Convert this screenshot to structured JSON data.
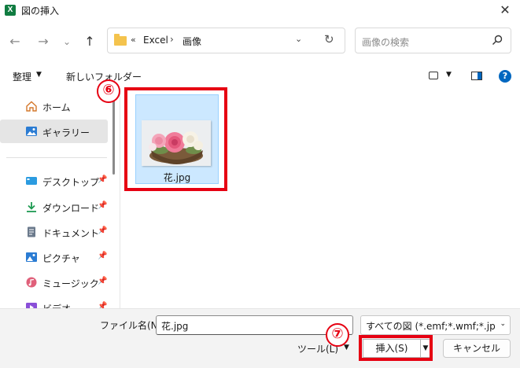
{
  "window": {
    "title": "図の挿入",
    "app_icon": "excel-icon",
    "close_label": "✕"
  },
  "nav": {
    "back": "←",
    "forward": "→",
    "recent": "⌄",
    "up": "↑"
  },
  "address": {
    "chevron": "«",
    "parts": [
      "Excel",
      "画像"
    ],
    "separator": "›"
  },
  "search": {
    "placeholder": "画像の検索"
  },
  "toolbar": {
    "organize": "整理",
    "new_folder": "新しいフォルダー"
  },
  "sidebar": {
    "items": [
      {
        "label": "ホーム",
        "icon": "home-icon",
        "pinned": false,
        "selected": false
      },
      {
        "label": "ギャラリー",
        "icon": "gallery-icon",
        "pinned": false,
        "selected": true
      },
      {
        "label": "デスクトップ",
        "icon": "desktop-icon",
        "pinned": true,
        "selected": false
      },
      {
        "label": "ダウンロード",
        "icon": "download-icon",
        "pinned": true,
        "selected": false
      },
      {
        "label": "ドキュメント",
        "icon": "document-icon",
        "pinned": true,
        "selected": false
      },
      {
        "label": "ピクチャ",
        "icon": "pictures-icon",
        "pinned": true,
        "selected": false
      },
      {
        "label": "ミュージック",
        "icon": "music-icon",
        "pinned": true,
        "selected": false
      },
      {
        "label": "ビデオ",
        "icon": "video-icon",
        "pinned": true,
        "selected": false
      }
    ]
  },
  "files": [
    {
      "name": "花.jpg",
      "selected": true,
      "thumbnail": "flower-basket-thumbnail"
    }
  ],
  "annotations": {
    "marker_6": "⑥",
    "marker_7": "⑦",
    "highlight_color": "#e60012"
  },
  "bottom": {
    "filename_label": "ファイル名(N):",
    "filename_value": "花.jpg",
    "filetype_value": "すべての図 (*.emf;*.wmf;*.jpg;*.jp",
    "tools_label": "ツール(L)",
    "insert_label": "挿入(S)",
    "cancel_label": "キャンセル"
  },
  "colors": {
    "accent": "#0067c0",
    "selection": "#cce8ff",
    "folder": "#f4c34d",
    "excel": "#107c41"
  }
}
